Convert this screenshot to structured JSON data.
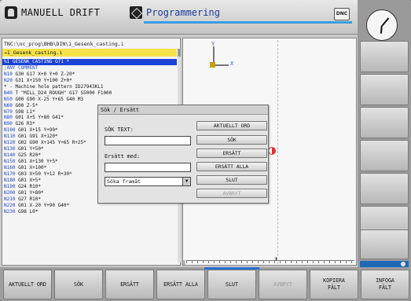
{
  "header": {
    "mode_manual": "MANUELL DRIFT",
    "mode_programming": "Programmering",
    "dnc_label": "DNC"
  },
  "program": {
    "path": "TNC:\\nc_prog\\BHB\\DIN\\1_Gesenk_casting.i",
    "selected_file": "→1_Gesenk_casting.i",
    "lines": [
      {
        "n": "%1",
        "text": " GESENK_CASTING G71 *",
        "active": true,
        "comment": false
      },
      {
        "n": "",
        "text": ";ANY COMMENT",
        "active": false,
        "comment": true
      },
      {
        "n": "N10",
        "text": " G30 G17 X+0 Y+0 Z-20*",
        "active": false,
        "comment": false
      },
      {
        "n": "N20",
        "text": " G31 X+150 Y+100 Z+0*",
        "active": false,
        "comment": false
      },
      {
        "n": "",
        "text": "* - Machine hole pattern ID27943KL1",
        "active": false,
        "comment": false
      },
      {
        "n": "N40",
        "text": " T \"MILL_D24_ROUGH\" G17 S5000 F1000",
        "active": false,
        "comment": false
      },
      {
        "n": "N50",
        "text": " G00 G90 X-25 Y+65 G40 M3",
        "active": false,
        "comment": false
      },
      {
        "n": "N60",
        "text": " G00 Z-5*",
        "active": false,
        "comment": false
      },
      {
        "n": "N70",
        "text": " G98 L1*",
        "active": false,
        "comment": false
      },
      {
        "n": "N80",
        "text": " G01 X+5 Y+80 G41*",
        "active": false,
        "comment": false
      },
      {
        "n": "N90",
        "text": " G26 R3*",
        "active": false,
        "comment": false
      },
      {
        "n": "N100",
        "text": " G01 X+15 Y+90*",
        "active": false,
        "comment": false
      },
      {
        "n": "N110",
        "text": " G01 G91 X+120*",
        "active": false,
        "comment": false
      },
      {
        "n": "N120",
        "text": " G02 G90 X+145 Y+65 R+25*",
        "active": false,
        "comment": false
      },
      {
        "n": "N130",
        "text": " G01 Y+50*",
        "active": false,
        "comment": false
      },
      {
        "n": "N140",
        "text": " G25 R20*",
        "active": false,
        "comment": false
      },
      {
        "n": "N150",
        "text": " G01 X+130 Y+5*",
        "active": false,
        "comment": false
      },
      {
        "n": "N160",
        "text": " G01 X+100*",
        "active": false,
        "comment": false
      },
      {
        "n": "N170",
        "text": " G03 X+50 Y+12 R+30*",
        "active": false,
        "comment": false
      },
      {
        "n": "N180",
        "text": " G01 X+5*",
        "active": false,
        "comment": false
      },
      {
        "n": "N190",
        "text": " G24 R10*",
        "active": false,
        "comment": false
      },
      {
        "n": "N200",
        "text": " G01 Y+80*",
        "active": false,
        "comment": false
      },
      {
        "n": "N210",
        "text": " G27 R10*",
        "active": false,
        "comment": false
      },
      {
        "n": "N220",
        "text": " G01 X-20 Y+90 G40*",
        "active": false,
        "comment": false
      },
      {
        "n": "N230",
        "text": " G98 L0*",
        "active": false,
        "comment": false
      }
    ]
  },
  "graphics": {
    "axis_y": "Y",
    "axis_x": "X"
  },
  "dialog": {
    "title": "Sök / Ersätt",
    "search_label": "SÖK TEXT:",
    "search_value": "",
    "replace_label": "Ersätt med:",
    "replace_value": "",
    "direction_value": "Söka framåt",
    "buttons": {
      "current_word": "AKTUELLT ORD",
      "search": "SÖK",
      "replace": "ERSÄTT",
      "replace_all": "ERSÄTT ALLA",
      "end": "SLUT",
      "cancel": "AVBRYT"
    }
  },
  "softkeys": {
    "current_word": "AKTUELLT ORD",
    "search": "SÖK",
    "replace": "ERSÄTT",
    "replace_all": "ERSÄTT ALLA",
    "end": "SLUT",
    "cancel": "AVBRYT",
    "copy_field": "KOPIERA\nFÄLT",
    "insert_field": "INFOGA\nFÄLT"
  }
}
